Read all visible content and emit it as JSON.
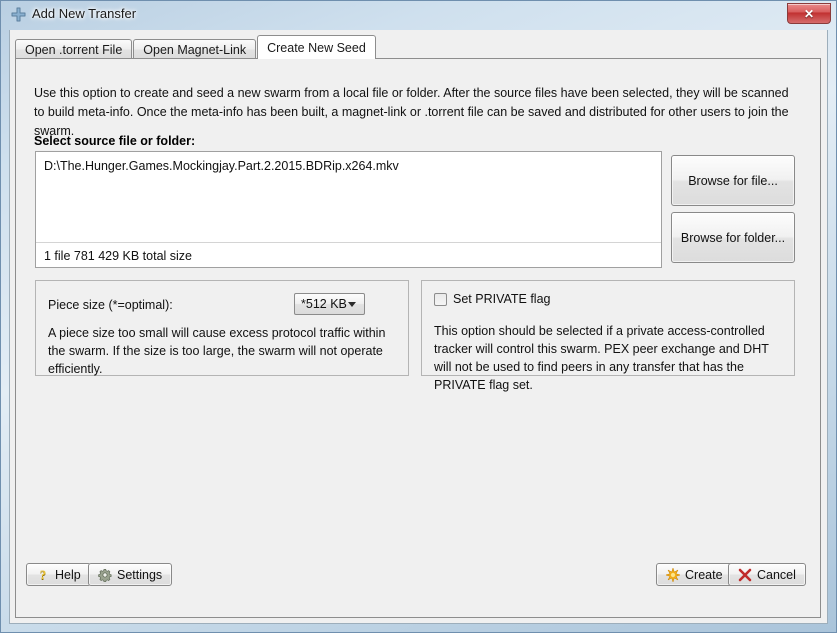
{
  "window": {
    "title": "Add New Transfer",
    "title_icon": "plus-icon",
    "close_label": "✕"
  },
  "tabs": [
    {
      "label": "Open .torrent File",
      "active": false
    },
    {
      "label": "Open Magnet-Link",
      "active": false
    },
    {
      "label": "Create New Seed",
      "active": true
    }
  ],
  "main": {
    "intro": "Use this option to create and seed a new swarm from a local file or folder.  After the source files have been selected, they will be scanned to build meta-info.  Once the meta-info has been built, a magnet-link or .torrent file can be saved and distributed for other users to join the swarm.",
    "source_label": "Select source file or folder:",
    "file_path": "D:\\The.Hunger.Games.Mockingjay.Part.2.2015.BDRip.x264.mkv",
    "file_status": "1 file  781 429 KB total size",
    "browse_file_label": "Browse for file...",
    "browse_folder_label": "Browse for folder..."
  },
  "piece_size_group": {
    "label": "Piece size (*=optimal):",
    "selected": "*512 KB",
    "options": [
      "*512 KB"
    ],
    "description": "A piece size too small will cause excess protocol traffic within the swarm.  If the size is too large, the swarm will not operate efficiently."
  },
  "private_group": {
    "checkbox_label": "Set PRIVATE flag",
    "checked": false,
    "description": "This option should be selected if a private access-controlled tracker will control this swarm.  PEX peer exchange and DHT will not be used to find peers in any transfer that has the PRIVATE flag set."
  },
  "footer": {
    "help_label": "Help",
    "help_icon": "question-mark-icon",
    "settings_label": "Settings",
    "settings_icon": "gear-icon",
    "create_label": "Create",
    "create_icon": "starburst-icon",
    "cancel_label": "Cancel",
    "cancel_icon": "x-icon"
  },
  "colors": {
    "client_bg": "#f0f0f0",
    "frame": "#6f8fae",
    "close_red": "#c03030",
    "accent_yellow": "#e8c23a",
    "cancel_red": "#c02b2b",
    "create_orange": "#f0a020"
  }
}
